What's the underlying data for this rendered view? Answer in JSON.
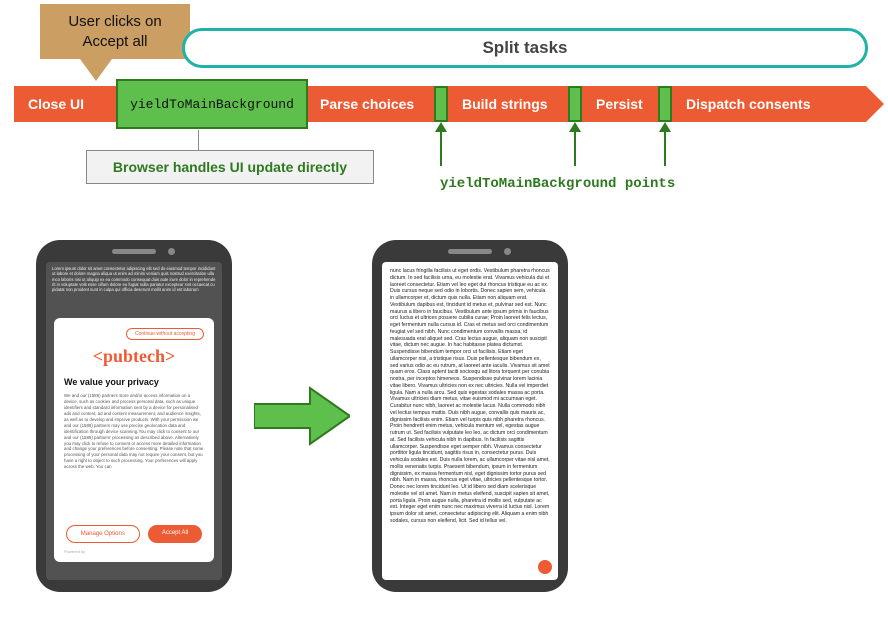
{
  "callout": {
    "text": "User clicks on Accept all"
  },
  "split_tasks_label": "Split tasks",
  "bar": {
    "close": "Close UI",
    "yield_main": "yieldToMainBackground",
    "parse": "Parse choices",
    "build": "Build strings",
    "persist": "Persist",
    "dispatch": "Dispatch consents"
  },
  "handles_text": "Browser handles UI update directly",
  "yield_points_text": "yieldToMainBackground points",
  "phone1": {
    "continue_label": "Continue without accepting",
    "logo": "<pubtech>",
    "headline": "We value your privacy",
    "body": "We and our (1589) partners store and/or access information on a device, such as cookies and process personal data, such as unique identifiers and standard information sent by a device for personalised ads and content, ad and content measurement, and audience insights, as well as to develop and improve products. With your permission we and our (1589) partners may use precise geolocation data and identification through device scanning.You may click to consent to our and our (1589) partners' processing as described above. Alternatively you may click to refuse to consent or access more detailed information and change your preferences before consenting. Please note that some processing of your personal data may not require your consent, but you have a right to object to such processing. Your preferences will apply across the web. You can",
    "manage_label": "Manage Options",
    "accept_label": "Accept All",
    "powered": "Powered by"
  },
  "phone2": {
    "body": "nunc lacus fringilla facilisis ut eget ordis. Vestibulum pharetra rhoncus dictum. In sed facilisis urna, eu molestie erat. Vivamus vehicula dui et laoreet consectetur. Etiam vel leo eget dui rhoncus tristique eu ac ex. Duis cursus neque sed odio in lobortis. Donec sapien sem, vehicula in ullamcorper et, dictum quis nulla. Etiam non aliquam erat. Vestibulum dapibus est, tincidunt id metus et, pulvinar sed est. Nunc maurus a libero in faucibus. Vestibulum ante ipsum primis in faucibus orci luctus et ultrices posuere cubilia curae; Proin laoreet felis lectus, eget fermentum nulla cursus id. Cras et metus sed orci condimentum feugiat vel sed nibh. Nunc condimentum convallis massa, id malesuada erat aliquet sed. Cras lectus augue, aliquam non suscipit vitae, dictum nec augue. In hac habitasse platea dictumst. Suspendisse bibendum tempor orci ut facilisis. Etiam eget ullamcorper nisi, a tristique risus. Duis pellentesque bibendum ex, sed varius odio ac eu rutrum, at laoreet ante iaculis. Vivamus sit amet quam eros. Class aptent taciti sociosqu ad litora torquent per conubia nostra, per inceptos himeneos. Suspendisse pulvinar lorem lacinia vitae libero. Vivamus ultricies non ex nec ultricies. Nulla vel imperdiet ligula. Nam a nulla arcu. Sed quis egestas sodales massa ac porta. Vivamus ultricies diam metus, vitae euismod mi accumsan eget. Curabitur nunc nibh, laoreet ac molestie lacus. Nulla commodo nibh vel lectus tempus mattis. Duis nibh augue, convallis quis mauris ac, dignissim facilisis enim. Etiam vel turpis quis nibh pharetra rhoncus. Proin hendrerit enim metus, vehicula mentum vel, egestas augue rutrum ut. Sed facilisis vulputate leo leo, ac dictum orci condimentum at. Sed facilisis vehicula nibh in dapibus. In facilisis sagittis ullamcorper. Suspendisse eget semper nibh. Vivamus consectetur porttitor ligula tincidunt, sagittis risus in, consectetur purus. Duis vehicula sodales est. Duis nulla lorem, ac ullamcorper vitae nisl amet, mollis venenatis turpis. Praesent bibendum, ipsum in fermentum dignissim, ex massa fermentum nisl, eget dignissim tortor purus sed nibh. Nam in massa, rhoncus eget vitae, ultricies pellentesque tortor. Donec nec lorem tincidunt leo. Ut id libero sed diam scelerisque molestie vel sit amet. Nam in metus eleifend, suscipit sapien sit amet, porta ligula. Proin augue nulla, pharetra id mollis sed, vulputate ac est. Integer eget enim nunc nec maximus viverra id luctus nisl. Lorem ipsum dolor sit amet, consectetur adipiscing elit. Aliquam a enim nibh sodales, cursus non eleifend, licit. Sed id tellus vel."
  },
  "colors": {
    "orange": "#ec5b33",
    "green": "#5fbf4d",
    "tan": "#cb9f63",
    "teal": "#20b2aa"
  }
}
